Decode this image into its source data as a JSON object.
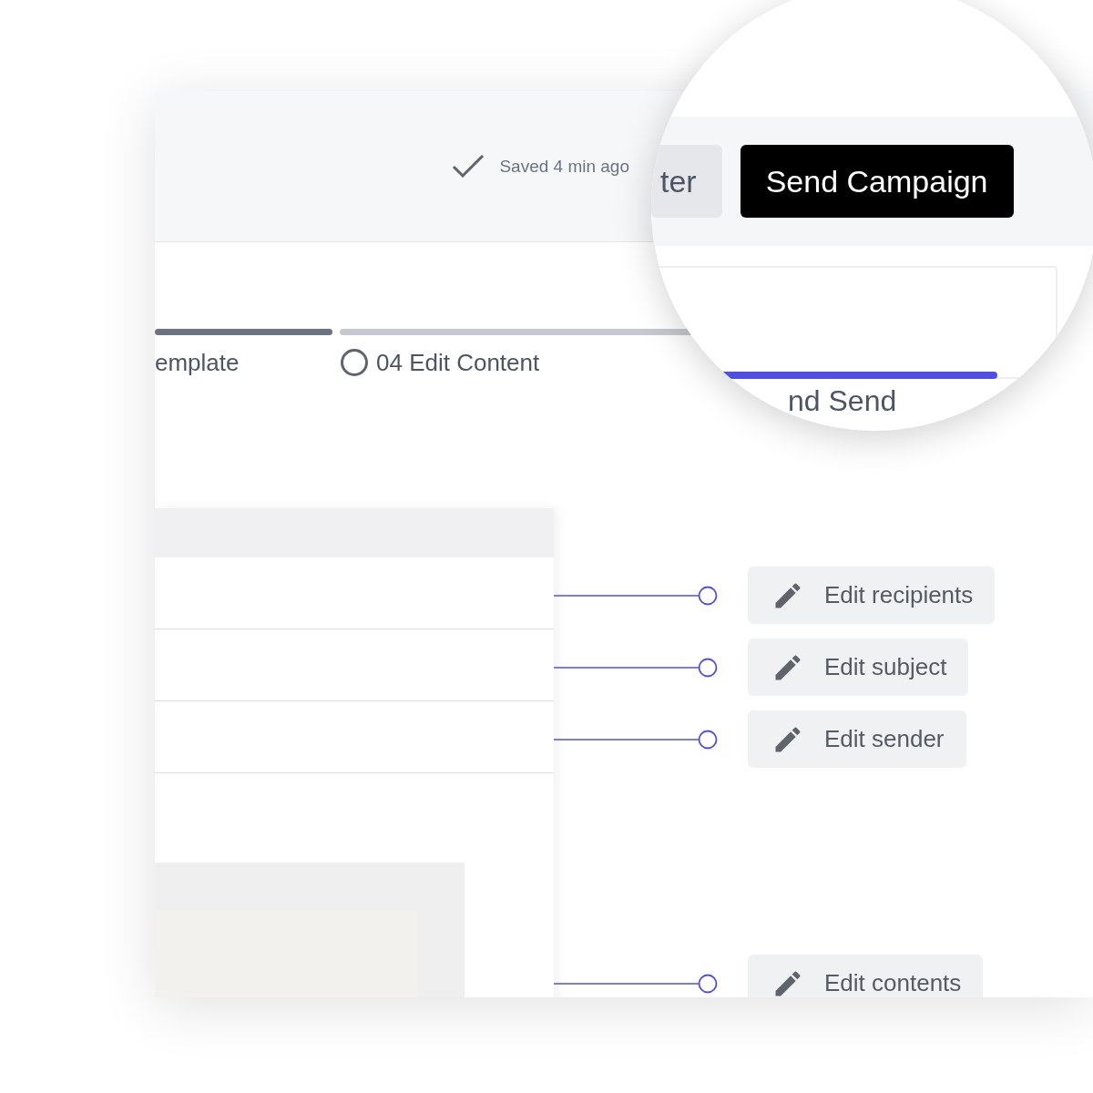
{
  "header": {
    "saved_text": "Saved 4 min ago"
  },
  "steps": [
    {
      "label": "emplate",
      "completed": true
    },
    {
      "label": "04 Edit Content",
      "completed": false
    }
  ],
  "annotations": [
    {
      "label": "Edit recipients"
    },
    {
      "label": "Edit subject"
    },
    {
      "label": "Edit sender"
    },
    {
      "label": "Edit contents"
    }
  ],
  "magnifier": {
    "buttons": [
      {
        "label": "ter",
        "kind": "secondary"
      },
      {
        "label": "Send Campaign",
        "kind": "primary"
      }
    ],
    "step": {
      "label": "nd Send",
      "active": true
    }
  }
}
